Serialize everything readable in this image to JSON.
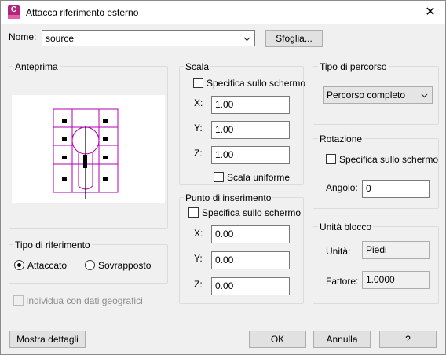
{
  "window": {
    "title": "Attacca riferimento esterno",
    "icon_letter": "C",
    "icon": "autocad-app-icon",
    "close_glyph": "✕"
  },
  "name": {
    "label": "Nome:",
    "value": "source",
    "browse_label": "Sfoglia..."
  },
  "preview": {
    "title": "Anteprima"
  },
  "reference_type": {
    "title": "Tipo di riferimento",
    "attached_label": "Attaccato",
    "overlay_label": "Sovrapposto",
    "selected": "Attaccato"
  },
  "geo_checkbox_label": "Individua con dati geografici",
  "scale": {
    "title": "Scala",
    "on_screen_label": "Specifica sullo schermo",
    "x_label": "X:",
    "x_value": "1.00",
    "y_label": "Y:",
    "y_value": "1.00",
    "z_label": "Z:",
    "z_value": "1.00",
    "uniform_label": "Scala uniforme"
  },
  "insertion_point": {
    "title": "Punto di inserimento",
    "on_screen_label": "Specifica sullo schermo",
    "x_label": "X:",
    "x_value": "0.00",
    "y_label": "Y:",
    "y_value": "0.00",
    "z_label": "Z:",
    "z_value": "0.00"
  },
  "path_type": {
    "title": "Tipo di percorso",
    "value": "Percorso completo"
  },
  "rotation": {
    "title": "Rotazione",
    "on_screen_label": "Specifica sullo schermo",
    "angle_label": "Angolo:",
    "angle_value": "0"
  },
  "block_unit": {
    "title": "Unità blocco",
    "unit_label": "Unità:",
    "unit_value": "Piedi",
    "factor_label": "Fattore:",
    "factor_value": "1.0000"
  },
  "footer": {
    "details_label": "Mostra dettagli",
    "ok_label": "OK",
    "cancel_label": "Annulla",
    "help_label": "?"
  },
  "colors": {
    "preview_lines": "#b000b0",
    "icon_bg": "#b4237c"
  }
}
